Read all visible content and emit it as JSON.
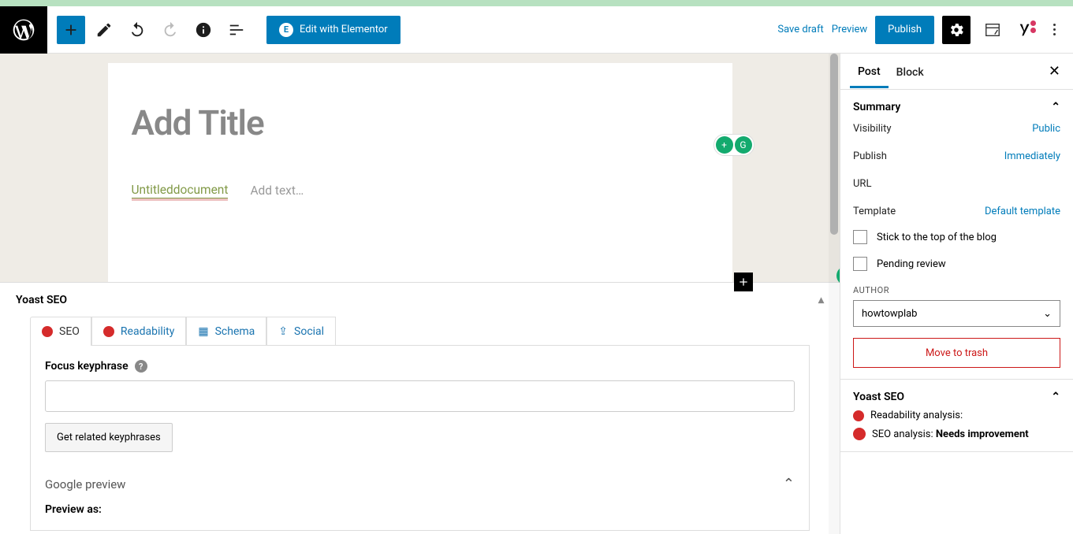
{
  "toolbar": {
    "elementor_label": "Edit with Elementor",
    "save_draft": "Save draft",
    "preview": "Preview",
    "publish": "Publish"
  },
  "editor": {
    "title_placeholder": "Add Title",
    "doc_link": "Untitleddocument",
    "add_text": "Add text…"
  },
  "yoast": {
    "title": "Yoast SEO",
    "tabs": {
      "seo": "SEO",
      "readability": "Readability",
      "schema": "Schema",
      "social": "Social"
    },
    "focus_label": "Focus keyphrase",
    "related_btn": "Get related keyphrases",
    "google_preview": "Google preview",
    "preview_as": "Preview as:"
  },
  "sidebar": {
    "tabs": {
      "post": "Post",
      "block": "Block"
    },
    "summary": {
      "title": "Summary",
      "visibility_label": "Visibility",
      "visibility_value": "Public",
      "publish_label": "Publish",
      "publish_value": "Immediately",
      "url_label": "URL",
      "template_label": "Template",
      "template_value": "Default template",
      "stick": "Stick to the top of the blog",
      "pending": "Pending review",
      "author_label": "AUTHOR",
      "author_value": "howtowplab",
      "trash": "Move to trash"
    },
    "yoast": {
      "title": "Yoast SEO",
      "readability": "Readability analysis:",
      "seo_label": "SEO analysis:",
      "seo_value": "Needs improvement"
    }
  }
}
